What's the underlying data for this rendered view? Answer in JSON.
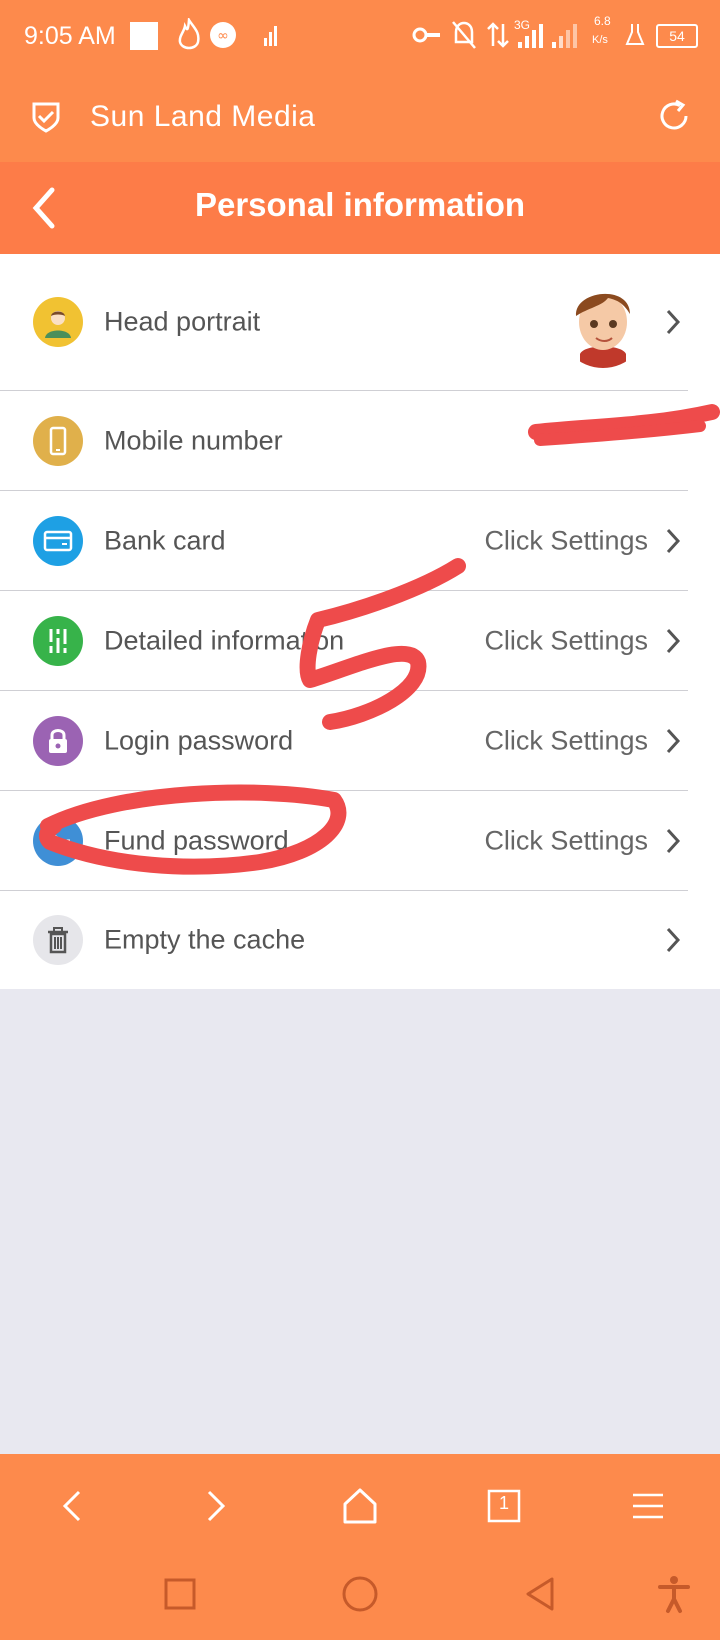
{
  "status_bar": {
    "time": "9:05 AM",
    "speed": "6.8",
    "speed_unit": "K/s",
    "network": "3G",
    "battery": "54"
  },
  "browser": {
    "title": "Sun Land Media"
  },
  "header": {
    "title": "Personal information"
  },
  "rows": [
    {
      "label": "Head portrait",
      "value": ""
    },
    {
      "label": "Mobile number",
      "value": ""
    },
    {
      "label": "Bank card",
      "value": "Click Settings"
    },
    {
      "label": "Detailed information",
      "value": "Click Settings"
    },
    {
      "label": "Login password",
      "value": "Click Settings"
    },
    {
      "label": "Fund password",
      "value": "Click Settings"
    },
    {
      "label": "Empty the cache",
      "value": ""
    }
  ],
  "bottom_nav": {
    "tab_count": "1"
  },
  "colors": {
    "brand": "#fd8a4c",
    "header": "#fd7c48",
    "scribble": "#ee4b4b"
  }
}
